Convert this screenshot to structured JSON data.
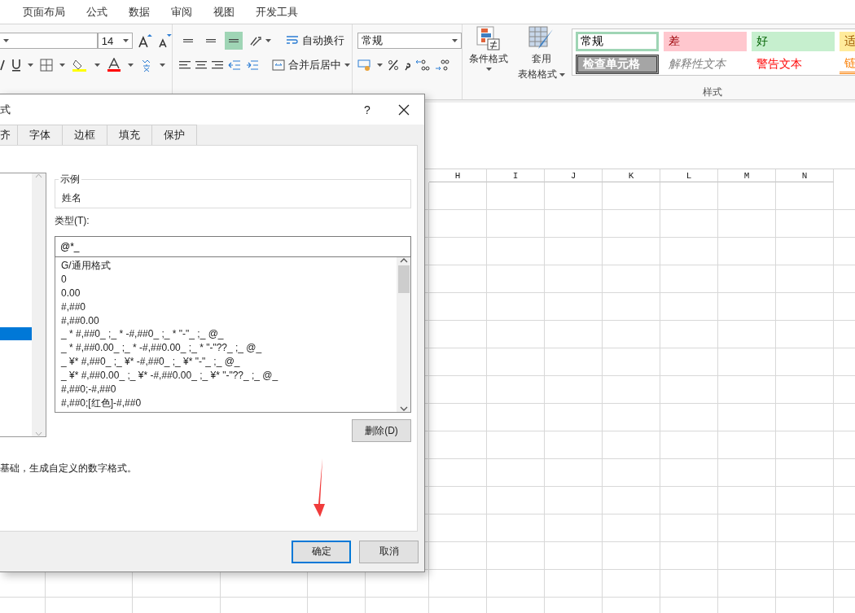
{
  "ribbon_tabs": [
    {
      "label": "页面布局",
      "selected": false
    },
    {
      "label": "公式",
      "selected": false
    },
    {
      "label": "数据",
      "selected": false
    },
    {
      "label": "审阅",
      "selected": false
    },
    {
      "label": "视图",
      "selected": false
    },
    {
      "label": "开发工具",
      "selected": false
    }
  ],
  "ribbon": {
    "font": {
      "size": "14"
    },
    "alignment": {
      "vertical_buttons": [
        {
          "on": false
        },
        {
          "on": false
        },
        {
          "on": true
        }
      ],
      "wrap_text": "自动换行",
      "merge_center": "合并后居中"
    },
    "number": {
      "format": "常规"
    },
    "styles": {
      "conditional_format": "条件格式",
      "table_format_line1": "套用",
      "table_format_line2": "表格格式",
      "label": "样式",
      "gallery": [
        {
          "text": "常规",
          "kind": "normal",
          "selected": true
        },
        {
          "text": "差",
          "kind": "bad",
          "selected": false
        },
        {
          "text": "好",
          "kind": "good",
          "selected": false
        },
        {
          "text": "适",
          "kind": "neutral",
          "selected": false
        },
        {
          "text": "检查单元格",
          "kind": "check",
          "selected": false
        },
        {
          "text": "解释性文本",
          "kind": "explanatory",
          "selected": false
        },
        {
          "text": "警告文本",
          "kind": "warning",
          "selected": false
        },
        {
          "text": "链",
          "kind": "linked",
          "selected": false
        }
      ]
    }
  },
  "sheet": {
    "columns": [
      "H",
      "I",
      "J",
      "K",
      "L",
      "M",
      "N"
    ]
  },
  "dialog": {
    "title": "式",
    "help": "?",
    "tabs": [
      {
        "label": "齐",
        "selected": false
      },
      {
        "label": "字体",
        "selected": false
      },
      {
        "label": "边框",
        "selected": false
      },
      {
        "label": "填充",
        "selected": false
      },
      {
        "label": "保护",
        "selected": false
      }
    ],
    "category_rows": [
      {
        "selected": false
      },
      {
        "selected": false
      },
      {
        "selected": false
      },
      {
        "selected": false
      },
      {
        "selected": false
      },
      {
        "selected": false
      },
      {
        "selected": false
      },
      {
        "selected": false
      },
      {
        "selected": false
      },
      {
        "selected": false
      },
      {
        "selected": false
      },
      {
        "selected": true
      }
    ],
    "sample_label": "示例",
    "sample_value": "姓名",
    "type_label": "类型(T):",
    "type_value": "@*_",
    "formats": [
      "G/通用格式",
      "0",
      "0.00",
      "#,##0",
      "#,##0.00",
      "_ * #,##0_ ;_ * -#,##0_ ;_ * \"-\"_ ;_ @_",
      "_ * #,##0.00_ ;_ * -#,##0.00_ ;_ * \"-\"??_ ;_ @_",
      "_ ¥* #,##0_ ;_ ¥* -#,##0_ ;_ ¥* \"-\"_ ;_ @_",
      "_ ¥* #,##0.00_ ;_ ¥* -#,##0.00_ ;_ ¥* \"-\"??_ ;_ @_",
      "#,##0;-#,##0",
      "#,##0;[红色]-#,##0"
    ],
    "delete_button": "删除(D)",
    "description": "基础，生成自定义的数字格式。",
    "ok_button": "确定",
    "cancel_button": "取消"
  }
}
